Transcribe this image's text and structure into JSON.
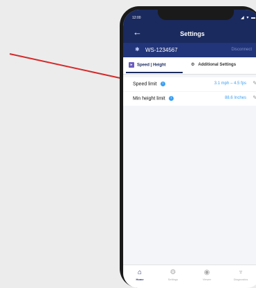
{
  "status": {
    "time": "12:00",
    "indicators": "◢ ▾ ▬"
  },
  "header": {
    "back_icon": "←",
    "title": "Settings"
  },
  "device": {
    "bluetooth_icon": "✱",
    "name": "WS-1234567",
    "disconnect": "Disconnect"
  },
  "tabs": [
    {
      "label": "Speed | Height",
      "icon": "▸"
    },
    {
      "label": "Additional Settings",
      "icon": "⚙"
    }
  ],
  "settings": [
    {
      "label": "Speed limit",
      "value": "3.1 mph – 4.5 fps"
    },
    {
      "label": "Min height limit",
      "value": "88.6 Inches"
    }
  ],
  "nav": [
    {
      "label": "Home",
      "icon": "⌂"
    },
    {
      "label": "Settings",
      "icon": "⚙"
    },
    {
      "label": "Viewer",
      "icon": "◉"
    },
    {
      "label": "Diagnostics",
      "icon": "♆"
    }
  ],
  "accent_color": "#1a2a5e",
  "arrow_color": "#d42a2a"
}
